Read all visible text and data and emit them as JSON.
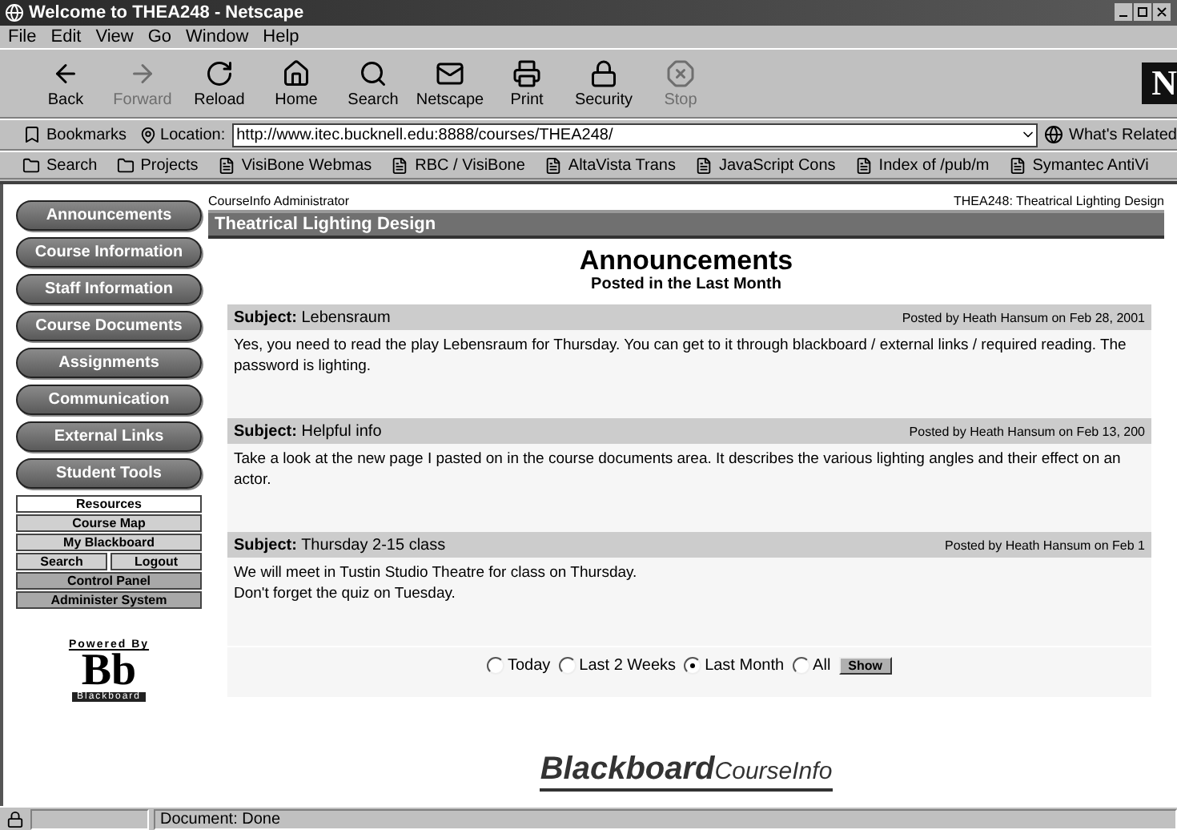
{
  "window": {
    "title": "Welcome to THEA248 - Netscape"
  },
  "menu": [
    {
      "label": "File"
    },
    {
      "label": "Edit"
    },
    {
      "label": "View"
    },
    {
      "label": "Go"
    },
    {
      "label": "Window"
    },
    {
      "label": "Help"
    }
  ],
  "toolbar": {
    "buttons": [
      {
        "kind": "back",
        "label": "Back",
        "disabled": false
      },
      {
        "kind": "forward",
        "label": "Forward",
        "disabled": true
      },
      {
        "kind": "reload",
        "label": "Reload",
        "disabled": false
      },
      {
        "kind": "home",
        "label": "Home",
        "disabled": false
      },
      {
        "kind": "search",
        "label": "Search",
        "disabled": false
      },
      {
        "kind": "netscape",
        "label": "Netscape",
        "disabled": false
      },
      {
        "kind": "print",
        "label": "Print",
        "disabled": false
      },
      {
        "kind": "security",
        "label": "Security",
        "disabled": false
      },
      {
        "kind": "stop",
        "label": "Stop",
        "disabled": true
      }
    ],
    "logo_letter": "N"
  },
  "location_bar": {
    "bookmarks": "Bookmarks",
    "label": "Location:",
    "value": "http://www.itec.bucknell.edu:8888/courses/THEA248/",
    "related": "What's Related"
  },
  "personal_bar": [
    {
      "kind": "folder",
      "label": "Search"
    },
    {
      "kind": "folder",
      "label": "Projects"
    },
    {
      "kind": "page",
      "label": "VisiBone Webmas"
    },
    {
      "kind": "page",
      "label": "RBC / VisiBone"
    },
    {
      "kind": "page",
      "label": "AltaVista Trans"
    },
    {
      "kind": "page",
      "label": "JavaScript Cons"
    },
    {
      "kind": "page",
      "label": "Index of /pub/m"
    },
    {
      "kind": "page",
      "label": "Symantec AntiVi"
    }
  ],
  "sidebar": {
    "nav_buttons": [
      {
        "label": "Announcements"
      },
      {
        "label": "Course Information"
      },
      {
        "label": "Staff Information"
      },
      {
        "label": "Course Documents"
      },
      {
        "label": "Assignments"
      },
      {
        "label": "Communication"
      },
      {
        "label": "External Links"
      },
      {
        "label": "Student Tools"
      }
    ],
    "tool_rows": [
      [
        {
          "label": "Resources",
          "kind": "header"
        }
      ],
      [
        {
          "label": "Course Map",
          "kind": "plain"
        }
      ],
      [
        {
          "label": "My Blackboard",
          "kind": "plain"
        }
      ],
      [
        {
          "label": "Search",
          "kind": "plain"
        },
        {
          "label": "Logout",
          "kind": "plain"
        }
      ],
      [
        {
          "label": "Control Panel",
          "kind": "admin"
        }
      ],
      [
        {
          "label": "Administer System",
          "kind": "admin"
        }
      ]
    ],
    "powered_by": {
      "caption": "Powered By",
      "mark": "Bb",
      "name": "Blackboard"
    }
  },
  "main": {
    "header_left": "CourseInfo Administrator",
    "header_right": "THEA248: Theatrical Lighting Design",
    "course_title": "Theatrical Lighting Design",
    "heading": "Announcements",
    "subheading": "Posted in the Last Month",
    "announcements": [
      {
        "subject_label": "Subject:",
        "subject": "Lebensraum",
        "posted": "Posted by Heath Hansum on Feb 28, 2001",
        "lines": [
          "Yes, you need to read the play Lebensraum for Thursday. You can get to it through blackboard / external links / required reading. The password is lighting."
        ]
      },
      {
        "subject_label": "Subject:",
        "subject": "Helpful info",
        "posted": "Posted by Heath Hansum on Feb 13, 200",
        "lines": [
          "Take a look at the new page I pasted on in the course documents area. It describes the various lighting angles and their effect on an actor."
        ]
      },
      {
        "subject_label": "Subject:",
        "subject": "Thursday 2-15 class",
        "posted": "Posted by Heath Hansum on Feb 1",
        "lines": [
          "We will meet in Tustin Studio Theatre for class on Thursday.",
          "Don't forget the quiz on Tuesday."
        ]
      }
    ],
    "filter": [
      {
        "label": "Today",
        "selected": false
      },
      {
        "label": "Last 2 Weeks",
        "selected": false
      },
      {
        "label": "Last Month",
        "selected": true
      },
      {
        "label": "All",
        "selected": false
      }
    ],
    "show_button": "Show",
    "footer_logo": {
      "bold": "Blackboard",
      "light": "CourseInfo"
    }
  },
  "status_bar": {
    "text": "Document: Done"
  }
}
